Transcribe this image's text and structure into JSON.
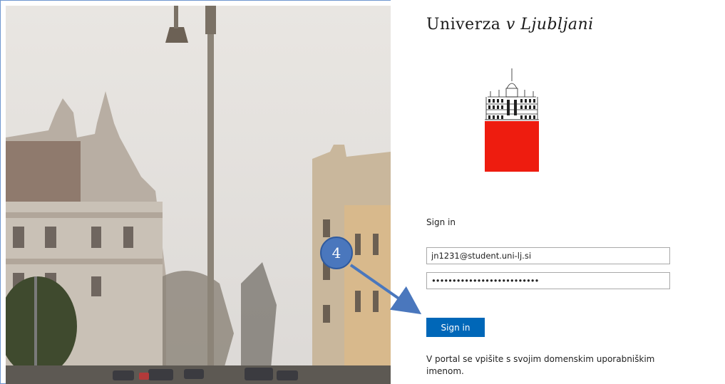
{
  "brand": {
    "name_regular": "Univerza ",
    "name_italic": "v Ljubljani"
  },
  "signin": {
    "heading": "Sign in",
    "email_value": "jn1231@student.uni-lj.si",
    "password_mask": "••••••••••••••••••••••••••",
    "button_label": "Sign in",
    "note": "V portal se vpišite s svojim domenskim uporabniškim imenom."
  },
  "annotation": {
    "step_number": "4"
  },
  "colors": {
    "button": "#0067b8",
    "logo_red": "#ee1c0f",
    "step_circle": "#4a77bd",
    "arrow": "#4a77bd"
  }
}
